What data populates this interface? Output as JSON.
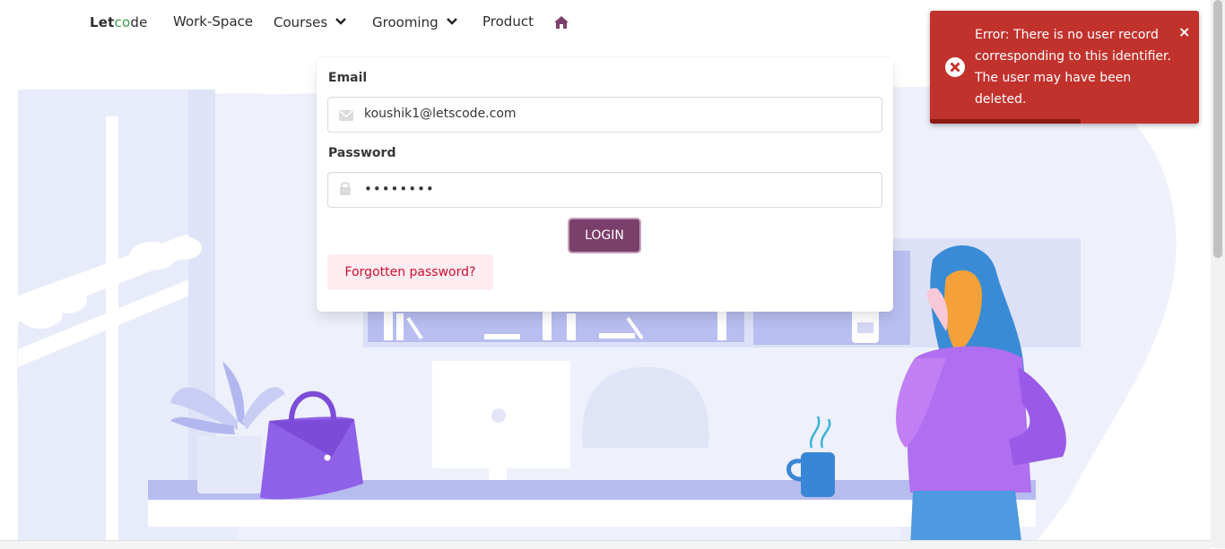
{
  "nav": {
    "logo": {
      "part1": "Let",
      "part2": "co",
      "part3": "de"
    },
    "items": [
      {
        "label": "Work-Space"
      },
      {
        "label": "Courses"
      },
      {
        "label": "Grooming"
      },
      {
        "label": "Product"
      }
    ],
    "home_icon": "home-icon",
    "chevron_icon": "chevron-down-icon"
  },
  "login": {
    "email_label": "Email",
    "email_value": "koushik1@letscode.com",
    "email_icon": "envelope-icon",
    "password_label": "Password",
    "password_mask": "••••••••",
    "password_icon": "lock-icon",
    "login_button": "LOGIN",
    "forgot_button": "Forgotten password?"
  },
  "toast": {
    "message": "Error: There is no user record corresponding to this identifier. The user may have been deleted.",
    "close_label": "×",
    "icon": "error-circle-icon",
    "progress": 0.56
  },
  "colors": {
    "primary": "#7b3f6b",
    "toast_bg": "#c2322d",
    "forgot_bg": "#feecf0",
    "forgot_text": "#cc0f35",
    "illustration_bg": "#eef0fb",
    "accent_purple": "#8f60e8"
  }
}
